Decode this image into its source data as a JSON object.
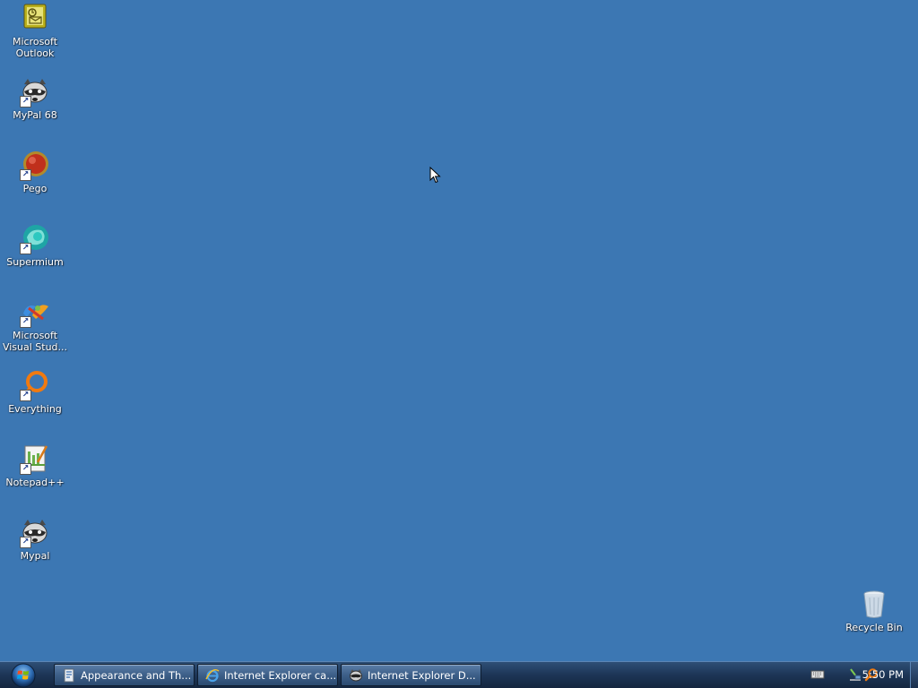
{
  "desktop": {
    "background_color": "#3c77b3",
    "icons": [
      {
        "name": "Microsoft\nOutlook",
        "icon": "outlook-icon",
        "shortcut": false
      },
      {
        "name": "MyPal 68",
        "icon": "raccoon-icon",
        "shortcut": true
      },
      {
        "name": "Pego",
        "icon": "pego-icon",
        "shortcut": true
      },
      {
        "name": "Supermium",
        "icon": "supermium-icon",
        "shortcut": true
      },
      {
        "name": "Microsoft\nVisual Stud...",
        "icon": "visual-studio-icon",
        "shortcut": true
      },
      {
        "name": "Everything",
        "icon": "everything-icon",
        "shortcut": true
      },
      {
        "name": "Notepad++",
        "icon": "notepad-plus-plus-icon",
        "shortcut": true
      },
      {
        "name": "Mypal",
        "icon": "raccoon-icon",
        "shortcut": true
      }
    ],
    "recycle_bin": {
      "name": "Recycle Bin",
      "icon": "recycle-bin-icon"
    }
  },
  "taskbar": {
    "start_icon": "windows-start-orb-icon",
    "buttons": [
      {
        "label": "Appearance and Th...",
        "icon": "control-panel-icon"
      },
      {
        "label": "Internet Explorer ca...",
        "icon": "internet-explorer-icon"
      },
      {
        "label": "Internet Explorer D...",
        "icon": "raccoon-icon"
      }
    ],
    "tray": {
      "icons": [
        "keyboard-icon",
        "network-icon",
        "search-icon"
      ],
      "clock": "5:50 PM"
    }
  }
}
